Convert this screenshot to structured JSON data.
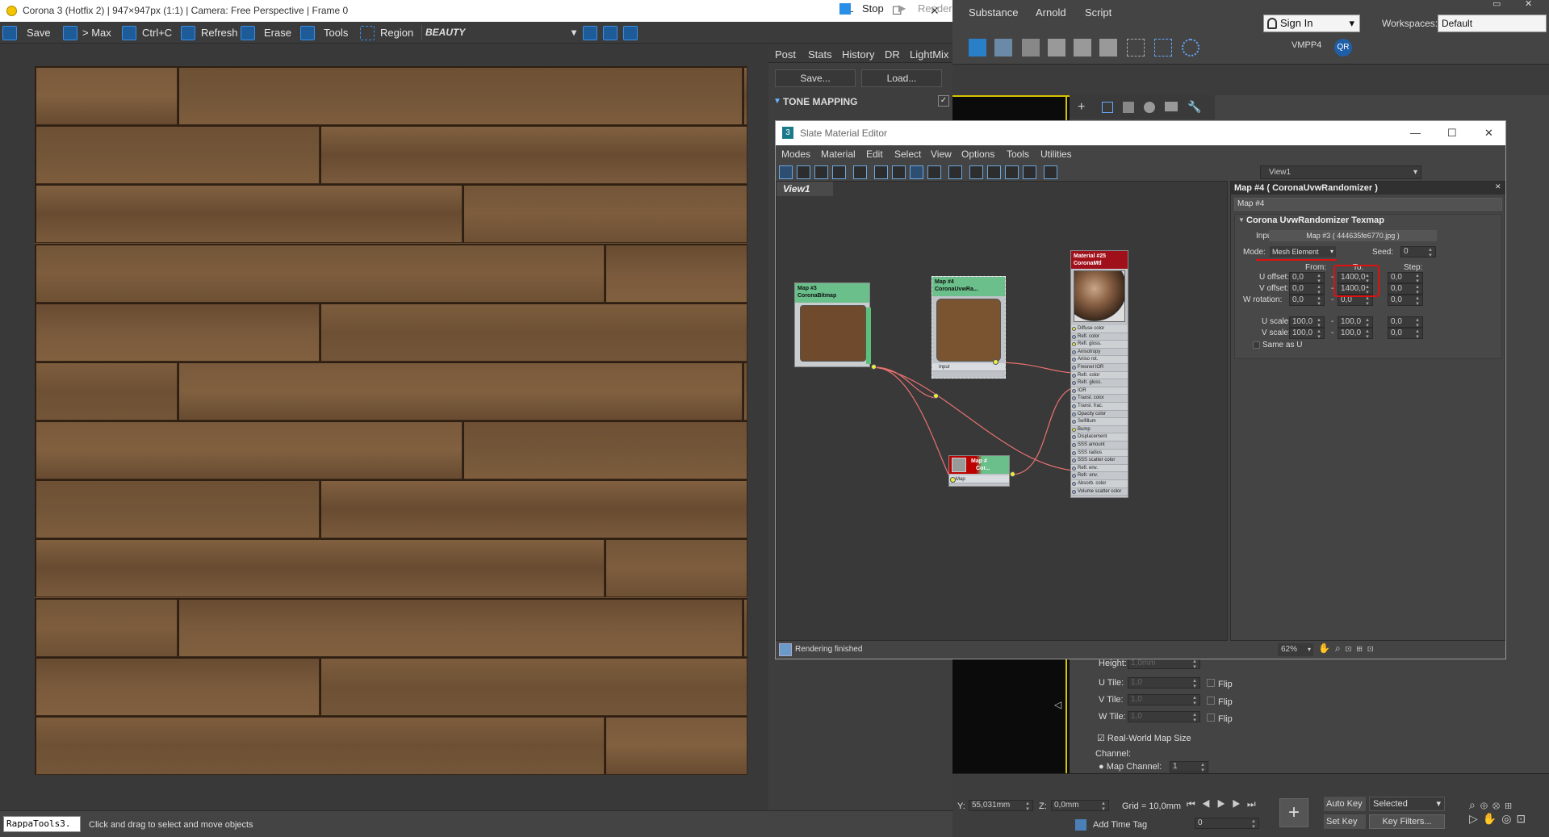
{
  "vfb": {
    "title": "Corona 3 (Hotfix 2) | 947×947px (1:1) | Camera: Free Perspective | Frame 0",
    "toolbar": {
      "save": "Save",
      "to_max": "> Max",
      "ctrl_c": "Ctrl+C",
      "refresh": "Refresh",
      "erase": "Erase",
      "tools": "Tools",
      "region": "Region",
      "channel": "BEAUTY",
      "stop": "Stop",
      "render": "Render"
    },
    "tabs": [
      "Post",
      "Stats",
      "History",
      "DR",
      "LightMix"
    ],
    "save_btn": "Save...",
    "load_btn": "Load...",
    "section": "TONE MAPPING"
  },
  "max": {
    "menu": [
      "Substance",
      "Arnold",
      "Script"
    ],
    "sign_in": "Sign In",
    "workspaces_label": "Workspaces:",
    "workspace_value": "Default",
    "vmpp": "VMPP4",
    "qr": "QR",
    "panel": {
      "height_label": "Height:",
      "height_value": "1,0mm",
      "u_tile_label": "U Tile:",
      "u_tile": "1,0",
      "v_tile_label": "V Tile:",
      "v_tile": "1,0",
      "w_tile_label": "W Tile:",
      "w_tile": "1,0",
      "flip": "Flip",
      "real_world": "Real-World Map Size",
      "channel": "Channel:",
      "map_channel": "Map Channel:",
      "map_channel_value": "1"
    },
    "bottom": {
      "y_label": "Y:",
      "y_value": "55,031mm",
      "z_label": "Z:",
      "z_value": "0,0mm",
      "grid": "Grid = 10,0mm",
      "add_time_tag": "Add Time Tag",
      "frame_value": "0",
      "auto_key": "Auto Key",
      "selected": "Selected",
      "set_key": "Set Key",
      "key_filters": "Key Filters..."
    },
    "status": {
      "maxscript": "RappaTools3.",
      "prompt": "Click and drag to select and move objects"
    }
  },
  "slate": {
    "title": "Slate Material Editor",
    "menu": [
      "Modes",
      "Material",
      "Edit",
      "Select",
      "View",
      "Options",
      "Tools",
      "Utilities"
    ],
    "view_dropdown": "View1",
    "view_tab": "View1",
    "status": "Rendering finished",
    "zoom": "62%",
    "nodes": {
      "bitmap": {
        "line1": "Map #3",
        "line2": "CoronaBitmap"
      },
      "randomizer": {
        "line1": "Map #4",
        "line2": "CoronaUvwRa...",
        "slot": "Input"
      },
      "bump": {
        "line1": "Map #",
        "line2": "Cor...",
        "slot": "Map"
      },
      "material": {
        "line1": "Material #25",
        "line2": "CoronaMtl",
        "slots": [
          "Diffuse color",
          "Refl. color",
          "Refl. gloss.",
          "Anisotropy",
          "Aniso rot.",
          "Fresnel IOR",
          "Refr. color",
          "Refr. gloss.",
          "IOR",
          "Transl. color",
          "Transl. frac.",
          "Opacity color",
          "Selfillum",
          "Bump",
          "Displacement",
          "SSS amount",
          "SSS radius",
          "SSS scatter color",
          "Refl. env.",
          "Refr. env.",
          "Absorb. color",
          "Volume scatter color"
        ]
      }
    },
    "props": {
      "header": "Map #4  ( CoronaUvwRandomizer )",
      "name": "Map #4",
      "rollout": "Corona UvwRandomizer Texmap",
      "input_label": "Input:",
      "input_value": "Map #3 ( 444635fe6770.jpg )",
      "mode_label": "Mode:",
      "mode_value": "Mesh Element",
      "seed_label": "Seed:",
      "seed_value": "0",
      "from": "From:",
      "to": "To:",
      "step": "Step:",
      "u_offset": "U offset:",
      "v_offset": "V offset:",
      "w_rotation": "W rotation:",
      "u_scale": "U scale:",
      "v_scale": "V scale:",
      "u_off_from": "0,0",
      "u_off_to": "1400,0",
      "u_off_step": "0,0",
      "v_off_from": "0,0",
      "v_off_to": "1400,0",
      "v_off_step": "0,0",
      "w_rot_from": "0,0",
      "w_rot_to": "0,0",
      "w_rot_step": "0,0",
      "u_sc_from": "100,0",
      "u_sc_to": "100,0",
      "u_sc_step": "0,0",
      "v_sc_from": "100,0",
      "v_sc_to": "100,0",
      "v_sc_step": "0,0",
      "dash": "-",
      "same_as_u": "Same as U"
    }
  }
}
